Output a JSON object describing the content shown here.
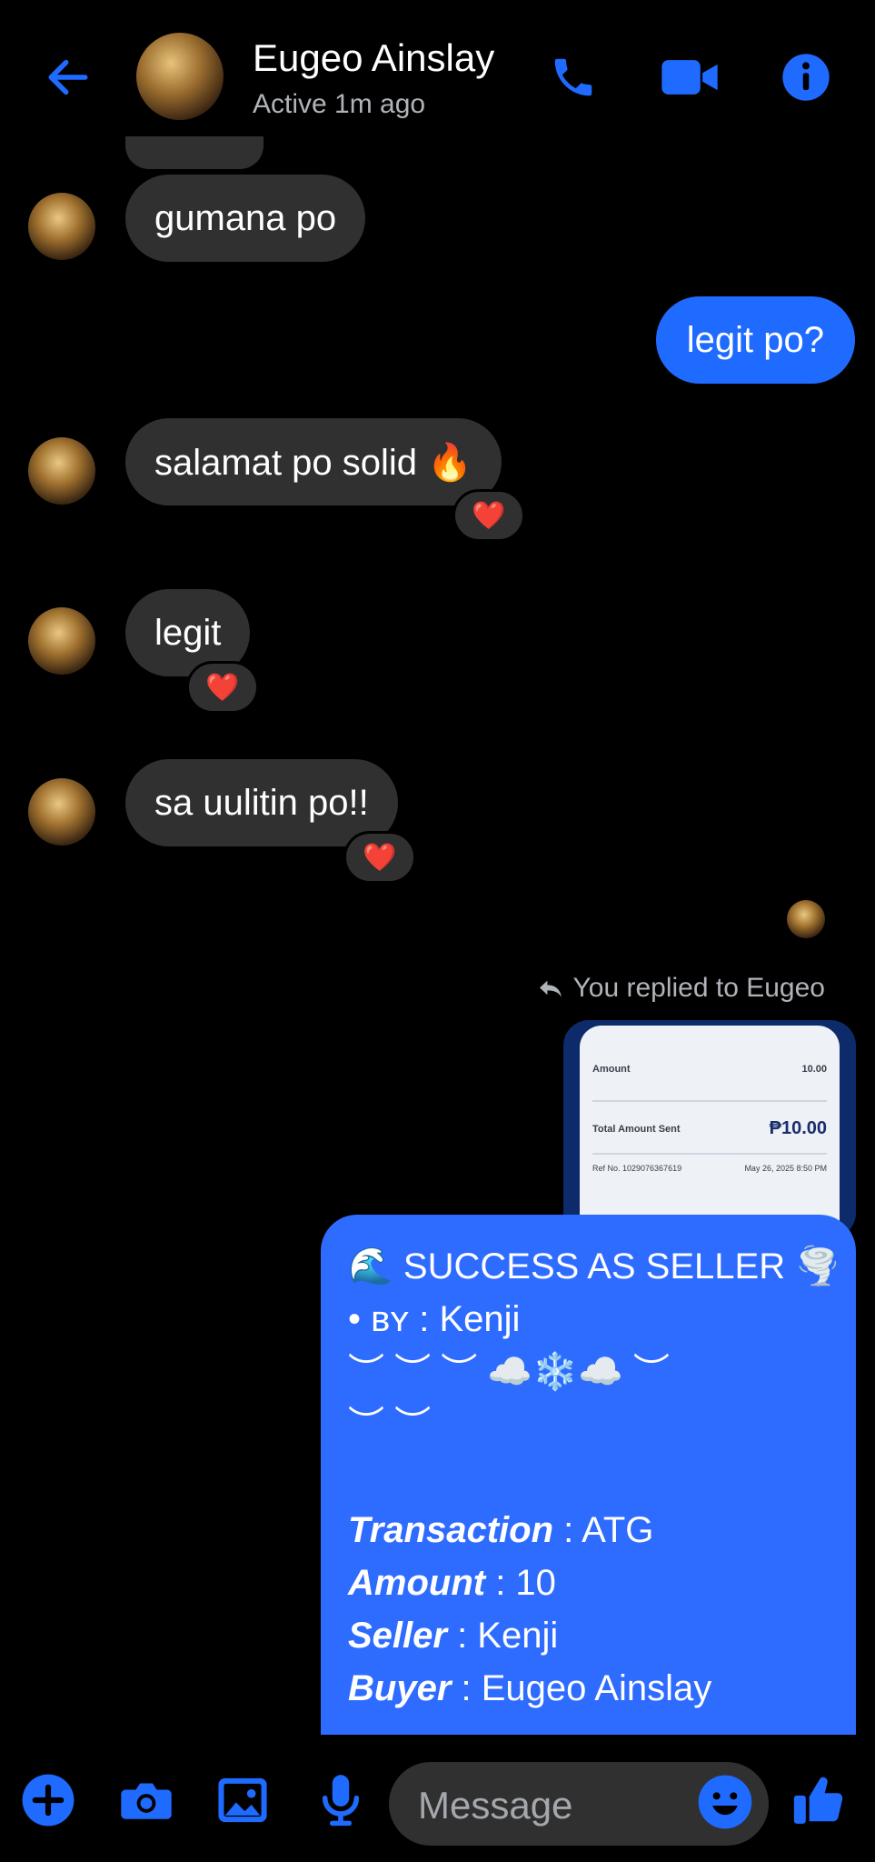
{
  "header": {
    "back_icon": "arrow-left-icon",
    "contact_name": "Eugeo Ainslay",
    "status": "Active 1m ago",
    "actions": [
      "phone-icon",
      "video-camera-icon",
      "info-icon"
    ],
    "accent_color": "#1f6bff"
  },
  "messages": [
    {
      "side": "in",
      "text": "gumana po"
    },
    {
      "side": "out",
      "text": "legit po?"
    },
    {
      "side": "in",
      "text": "salamat po solid 🔥",
      "reaction": "❤️"
    },
    {
      "side": "in",
      "text": "legit",
      "reaction": "❤️"
    },
    {
      "side": "in",
      "text": "sa uulitin po!!",
      "reaction": "❤️"
    }
  ],
  "reply": {
    "label": "You replied to Eugeo",
    "thumbnail": {
      "row1_label": "Amount",
      "row1_value": "10.00",
      "row2_label": "Total Amount Sent",
      "row2_value": "₱10.00",
      "ref_label": "Ref No. 1029076367619",
      "ref_date": "May 26, 2025 8:50 PM"
    },
    "card": {
      "line1": "🌊 SUCCESS AS SELLER 🌪️",
      "line2": "• ʙʏ : Kenji",
      "line3": "︶ ︶ ︶ ☁️❄️☁️ ︶",
      "line4": "︶ ︶",
      "fields": [
        {
          "key": "Transaction",
          "value": " : ATG"
        },
        {
          "key": "Amount",
          "value": " : 10"
        },
        {
          "key": "Seller",
          "value": " : Kenji"
        },
        {
          "key": "Buyer",
          "value": " : Eugeo Ainslay"
        }
      ]
    }
  },
  "composer": {
    "placeholder": "Message",
    "icons": [
      "plus-icon",
      "camera-icon",
      "image-icon",
      "microphone-icon",
      "emoji-icon",
      "thumbs-up-icon"
    ]
  }
}
